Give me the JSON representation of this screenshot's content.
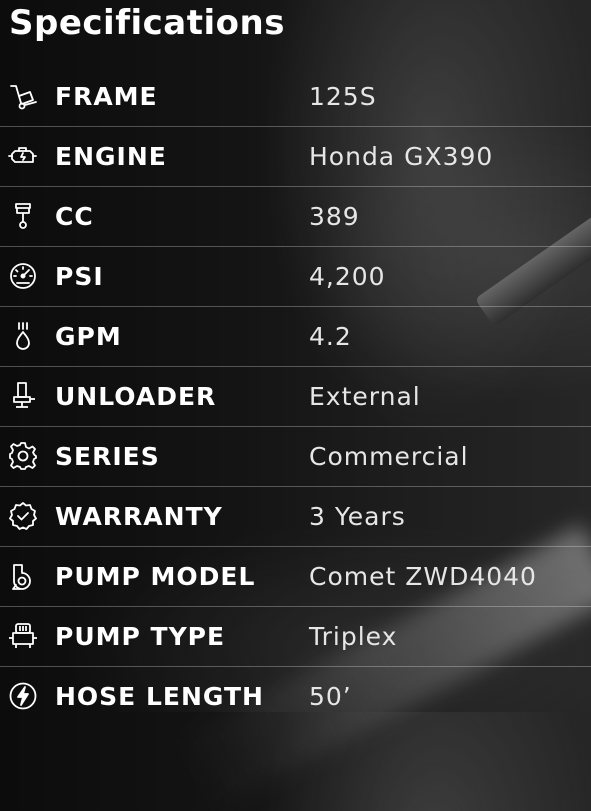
{
  "title": "Specifications",
  "specs": [
    {
      "icon": "hand-truck-icon",
      "label": "FRAME",
      "value": "125S"
    },
    {
      "icon": "engine-icon",
      "label": "ENGINE",
      "value": "Honda GX390"
    },
    {
      "icon": "piston-icon",
      "label": "CC",
      "value": "389"
    },
    {
      "icon": "pressure-gauge-icon",
      "label": "PSI",
      "value": "4,200"
    },
    {
      "icon": "water-drop-icon",
      "label": "GPM",
      "value": "4.2"
    },
    {
      "icon": "valve-icon",
      "label": "UNLOADER",
      "value": "External"
    },
    {
      "icon": "gear-icon",
      "label": "SERIES",
      "value": "Commercial"
    },
    {
      "icon": "badge-check-icon",
      "label": "WARRANTY",
      "value": "3 Years"
    },
    {
      "icon": "pump-icon",
      "label": "PUMP MODEL",
      "value": "Comet ZWD4040"
    },
    {
      "icon": "triplex-pump-icon",
      "label": "PUMP TYPE",
      "value": "Triplex"
    },
    {
      "icon": "lightning-circle-icon",
      "label": "HOSE LENGTH",
      "value": "50’"
    }
  ]
}
